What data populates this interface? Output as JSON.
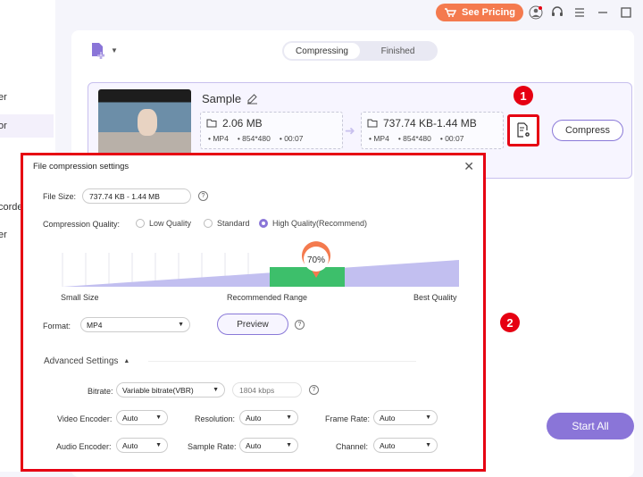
{
  "sidebar": {
    "items": [
      {
        "label": "er",
        "active": false
      },
      {
        "label": "or",
        "active": true
      },
      {
        "label": "corde",
        "active": false
      },
      {
        "label": "er",
        "active": false
      }
    ]
  },
  "topbar": {
    "pricing_label": "See Pricing",
    "icons": [
      "user-icon",
      "headset-icon",
      "menu-icon",
      "minimize-icon",
      "maximize-icon"
    ]
  },
  "tabs": [
    {
      "label": "Compressing",
      "active": true
    },
    {
      "label": "Finished",
      "active": false
    }
  ],
  "file": {
    "name": "Sample",
    "original": {
      "size": "2.06 MB",
      "format": "MP4",
      "resolution": "854*480",
      "duration": "00:07"
    },
    "output": {
      "size": "737.74 KB-1.44 MB",
      "format": "MP4",
      "resolution": "854*480",
      "duration": "00:07"
    },
    "compress_label": "Compress"
  },
  "badges": {
    "one": "1",
    "two": "2"
  },
  "start_all_label": "Start All",
  "dialog": {
    "title": "File compression settings",
    "file_size_label": "File Size:",
    "file_size_value": "737.74 KB - 1.44 MB",
    "quality_label": "Compression Quality:",
    "quality_options": [
      {
        "label": "Low Quality",
        "selected": false
      },
      {
        "label": "Standard",
        "selected": false
      },
      {
        "label": "High Quality(Recommend)",
        "selected": true
      }
    ],
    "slider": {
      "value_label": "70%",
      "value": 70,
      "left_label": "Small Size",
      "mid_label": "Recommended Range",
      "right_label": "Best Quality"
    },
    "format_label": "Format:",
    "format_value": "MP4",
    "preview_label": "Preview",
    "advanced_label": "Advanced Settings",
    "bitrate_label": "Bitrate:",
    "bitrate_value": "Variable bitrate(VBR)",
    "bitrate_placeholder": "1804 kbps",
    "video_encoder_label": "Video Encoder:",
    "video_encoder_value": "Auto",
    "resolution_label": "Resolution:",
    "resolution_value": "Auto",
    "frame_rate_label": "Frame Rate:",
    "frame_rate_value": "Auto",
    "audio_encoder_label": "Audio Encoder:",
    "audio_encoder_value": "Auto",
    "sample_rate_label": "Sample Rate:",
    "sample_rate_value": "Auto",
    "channel_label": "Channel:",
    "channel_value": "Auto"
  },
  "colors": {
    "accent": "#8a75d8",
    "highlight": "#e60012",
    "pricing": "#f47a4e",
    "slider_green": "#3dbf6b",
    "slider_thumb": "#f47a4e"
  }
}
